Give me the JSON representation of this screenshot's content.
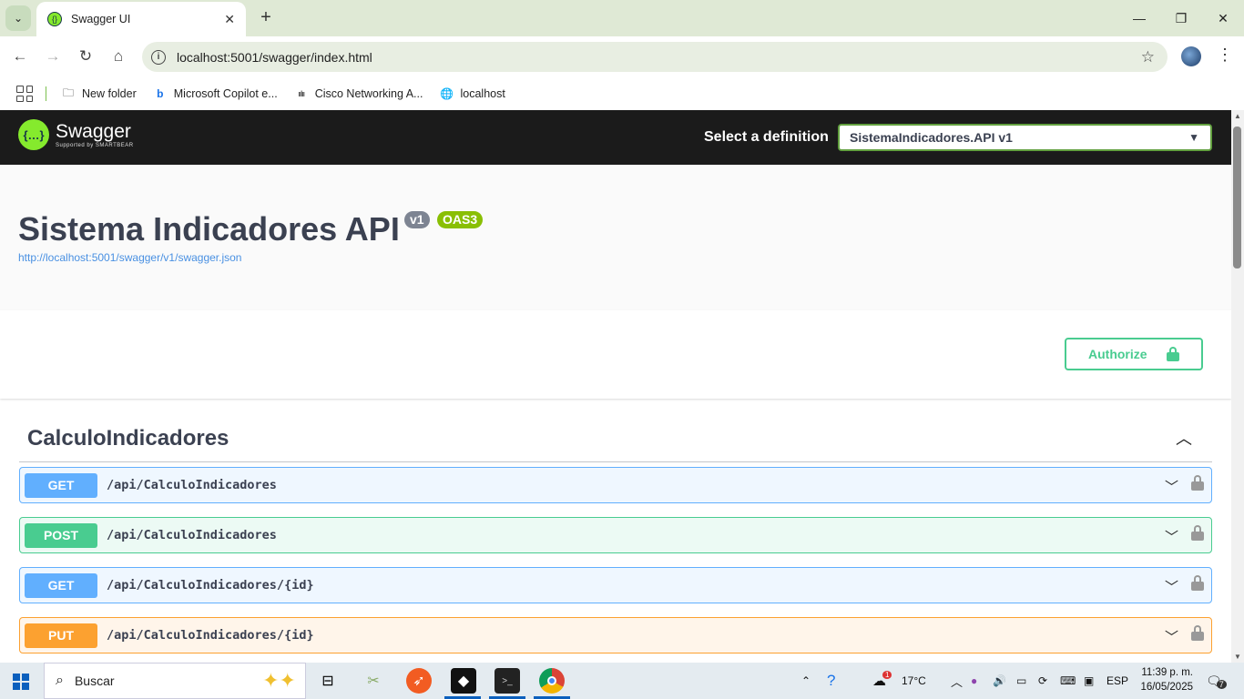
{
  "browser": {
    "tab_title": "Swagger UI",
    "url": "localhost:5001/swagger/index.html",
    "bookmarks": [
      {
        "label": "New folder",
        "icon": "folder-icon"
      },
      {
        "label": "Microsoft Copilot e...",
        "icon": "bing-icon"
      },
      {
        "label": "Cisco Networking A...",
        "icon": "cisco-icon"
      },
      {
        "label": "localhost",
        "icon": "globe-icon"
      }
    ]
  },
  "swagger": {
    "brand": "Swagger",
    "brand_sub": "Supported by SMARTBEAR",
    "select_label": "Select a definition",
    "selected_definition": "SistemaIndicadores.API v1",
    "api_title": "Sistema Indicadores API",
    "version_badge": "v1",
    "oas_badge": "OAS3",
    "spec_url": "http://localhost:5001/swagger/v1/swagger.json",
    "authorize_label": "Authorize",
    "tag": {
      "name": "CalculoIndicadores",
      "operations": [
        {
          "method": "GET",
          "path": "/api/CalculoIndicadores"
        },
        {
          "method": "POST",
          "path": "/api/CalculoIndicadores"
        },
        {
          "method": "GET",
          "path": "/api/CalculoIndicadores/{id}"
        },
        {
          "method": "PUT",
          "path": "/api/CalculoIndicadores/{id}"
        }
      ]
    }
  },
  "colors": {
    "get": "#61affe",
    "post": "#49cc90",
    "put": "#fca130",
    "topbar": "#1b1b1b",
    "swagger_green": "#85ea2d"
  },
  "taskbar": {
    "search_placeholder": "Buscar",
    "weather": "17°C",
    "weather_badge": "1",
    "language": "ESP",
    "time": "11:39 p. m.",
    "date": "16/05/2025",
    "notifications": "7"
  }
}
